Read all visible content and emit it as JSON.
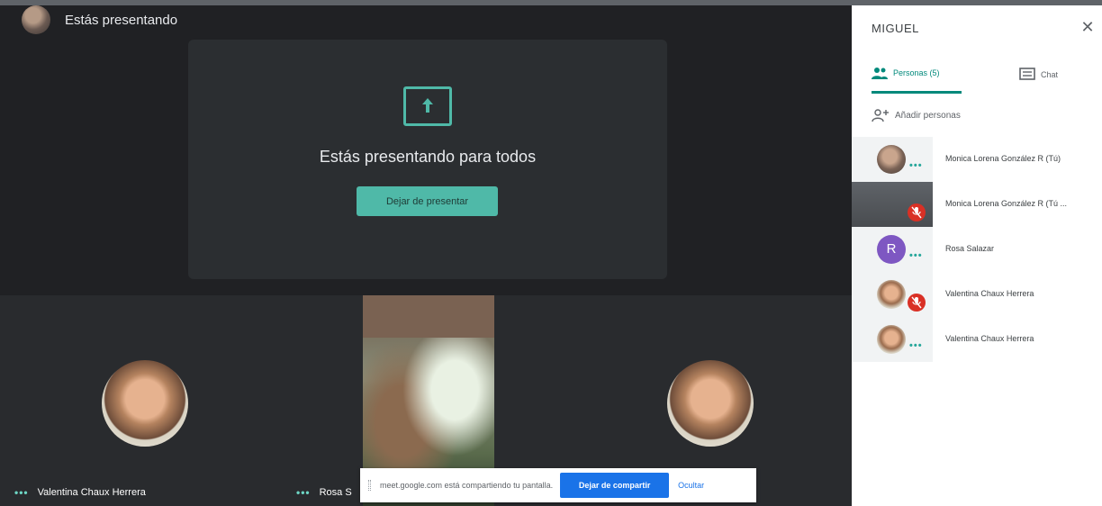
{
  "presenting": {
    "label": "Estás presentando",
    "card_title": "Estás presentando para todos",
    "stop_button": "Dejar de presentar"
  },
  "tiles": [
    {
      "name": "Valentina Chaux Herrera"
    },
    {
      "name": "Rosa S"
    }
  ],
  "share_notice": {
    "text": "meet.google.com está compartiendo tu pantalla.",
    "stop_button": "Dejar de compartir",
    "hide_button": "Ocultar"
  },
  "panel": {
    "title": "MIGUEL",
    "close_icon": "✕",
    "tabs": [
      {
        "label": "Personas (5)",
        "icon": "people-icon",
        "active": true
      },
      {
        "label": "Chat",
        "icon": "chat-icon",
        "active": false
      }
    ],
    "add_people": "Añadir personas",
    "people": [
      {
        "name": "Monica Lorena González R (Tú)",
        "avatar": "photo",
        "state": "dots"
      },
      {
        "name": "Monica Lorena González R (Tú ...",
        "avatar": "video",
        "state": "muted"
      },
      {
        "name": "Rosa Salazar",
        "avatar": "letter",
        "letter": "R",
        "state": "dots"
      },
      {
        "name": "Valentina Chaux Herrera",
        "avatar": "girl",
        "state": "muted"
      },
      {
        "name": "Valentina Chaux Herrera",
        "avatar": "girl",
        "state": "dots"
      }
    ]
  },
  "colors": {
    "accent_teal": "#4fb9a8",
    "active_tab": "#00897b",
    "share_blue": "#1a73e8",
    "mute_red": "#d93025",
    "stage_bg": "#202124"
  }
}
